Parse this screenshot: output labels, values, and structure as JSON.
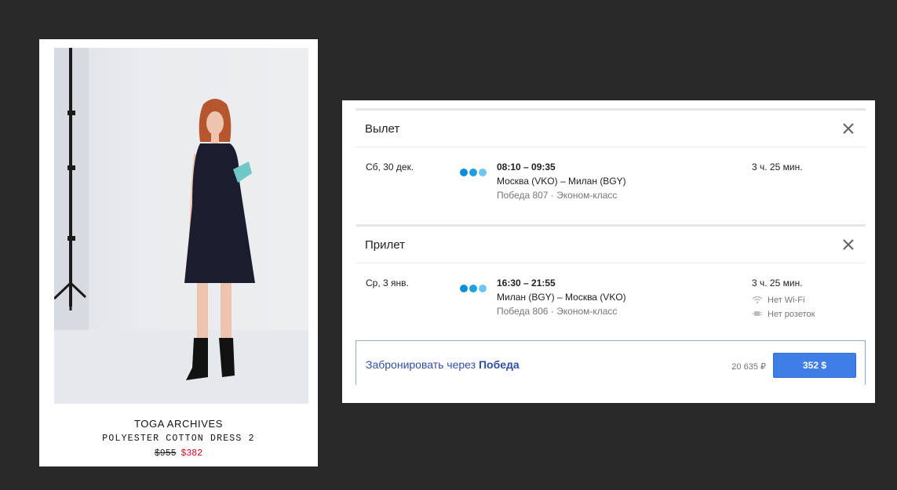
{
  "product": {
    "brand": "TOGA ARCHIVES",
    "name": "POLYESTER COTTON DRESS 2",
    "price_old": "$955",
    "price_new": "$382"
  },
  "flights": {
    "depart": {
      "title": "Вылет",
      "date": "Сб, 30 дек.",
      "times": "08:10 – 09:35",
      "route": "Москва (VKO) – Милан (BGY)",
      "carrier": "Победа 807 · Эконом-класс",
      "duration": "3 ч. 25 мин."
    },
    "arrive": {
      "title": "Прилет",
      "date": "Ср, 3 янв.",
      "times": "16:30 – 21:55",
      "route": "Милан (BGY) – Москва (VKO)",
      "carrier": "Победа 806 · Эконом-класс",
      "duration": "3 ч. 25 мин.",
      "wifi": "Нет Wi-Fi",
      "power": "Нет розеток"
    },
    "booking": {
      "text_prefix": "Забронировать через",
      "airline": "Победа",
      "price_rub": "20 635 ₽",
      "price_button": "352 $"
    }
  },
  "icons": {
    "close": "close-icon",
    "wifi": "wifi-icon",
    "power": "power-plug-icon",
    "airline": "airline-logo-icon"
  },
  "colors": {
    "background": "#282828",
    "accent_blue": "#3f7ee6",
    "link_blue": "#2f4fa3",
    "sale_red": "#d0021b"
  }
}
